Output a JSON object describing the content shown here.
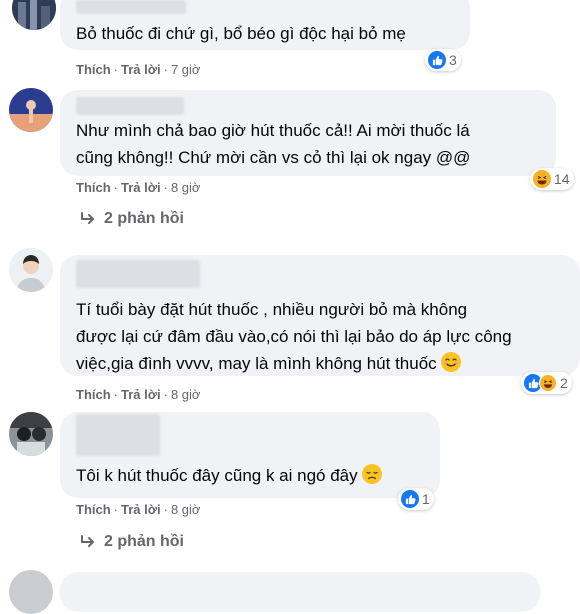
{
  "comments": [
    {
      "text_lines": [
        "Bỏ thuốc đi chứ gì, bổ béo gì độc hại bỏ mẹ"
      ],
      "like_label": "Thích",
      "reply_label": "Trả lời",
      "time": "7 giờ",
      "reaction_count": "3",
      "reaction_icons": [
        "like-icon"
      ]
    },
    {
      "text_lines": [
        "Như mình chả bao giờ hút thuốc cả!! Ai mời thuốc lá",
        "cũng không!! Chứ mời cần vs cỏ thì lại ok ngay @@"
      ],
      "like_label": "Thích",
      "reply_label": "Trả lời",
      "time": "8 giờ",
      "reaction_count": "14",
      "reaction_icons": [
        "haha-icon"
      ],
      "replies_label": "2 phản hồi"
    },
    {
      "text_lines": [
        "Tí tuổi bày đặt hút thuốc , nhiều người bỏ mà không",
        "được lại cứ đâm đầu vào,có nói thì lại bảo do áp lực công",
        "việc,gia đình vvvv, may là mình không hút thuốc"
      ],
      "like_label": "Thích",
      "reply_label": "Trả lời",
      "time": "8 giờ",
      "reaction_count": "2",
      "reaction_icons": [
        "like-icon",
        "haha-icon"
      ],
      "text_emoji": "smiling-face-icon"
    },
    {
      "text_lines": [
        "Tôi k hút thuốc đây cũng k ai ngó đây"
      ],
      "like_label": "Thích",
      "reply_label": "Trả lời",
      "time": "8 giờ",
      "reaction_count": "1",
      "reaction_icons": [
        "like-icon"
      ],
      "replies_label": "2 phản hồi",
      "text_emoji": "disappointed-face-icon"
    }
  ],
  "colors": {
    "bubble": "#f0f2f5",
    "meta_text": "#65676b",
    "like_blue": "#1877f2",
    "haha_yellow": "#f7b125"
  }
}
